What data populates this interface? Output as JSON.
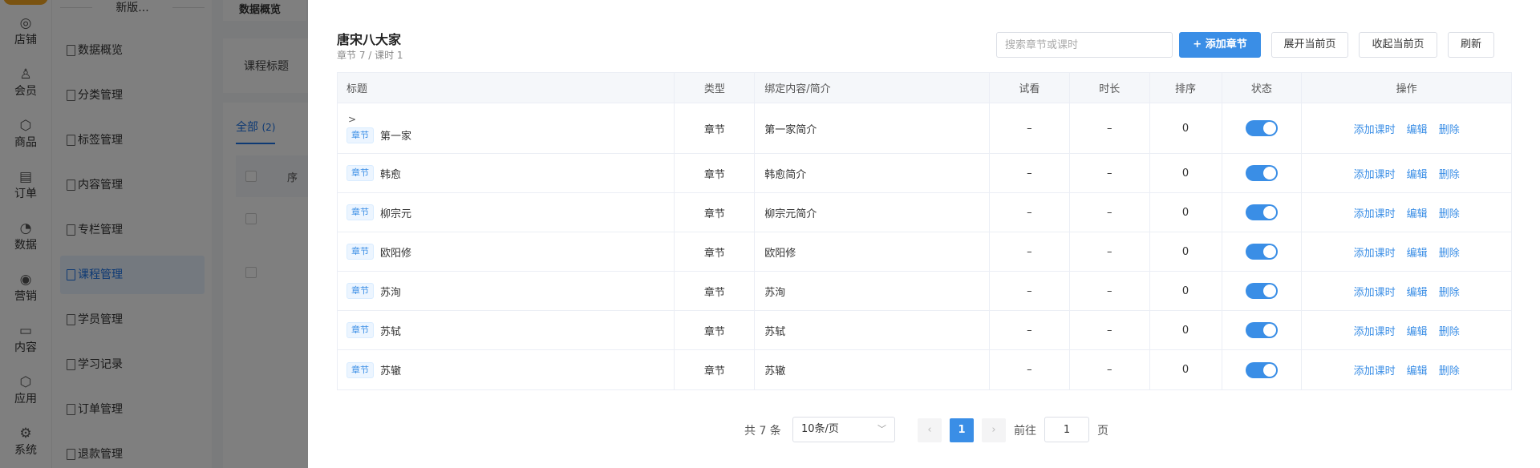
{
  "rail": {
    "items": [
      {
        "label": "店铺",
        "icon": "store-icon",
        "glyph": "◎"
      },
      {
        "label": "会员",
        "icon": "member-icon",
        "glyph": "♙"
      },
      {
        "label": "商品",
        "icon": "goods-icon",
        "glyph": "⬡"
      },
      {
        "label": "订单",
        "icon": "order-icon",
        "glyph": "▤"
      },
      {
        "label": "数据",
        "icon": "data-icon",
        "glyph": "◔"
      },
      {
        "label": "营销",
        "icon": "marketing-icon",
        "glyph": "◉"
      },
      {
        "label": "内容",
        "icon": "content-icon",
        "glyph": "▭"
      },
      {
        "label": "应用",
        "icon": "app-icon",
        "glyph": "⬡"
      },
      {
        "label": "系统",
        "icon": "system-icon",
        "glyph": "⚙"
      }
    ]
  },
  "sidebar": {
    "top_label": "新版...",
    "items": [
      {
        "label": "数据概览"
      },
      {
        "label": "分类管理"
      },
      {
        "label": "标签管理"
      },
      {
        "label": "内容管理"
      },
      {
        "label": "专栏管理"
      },
      {
        "label": "课程管理",
        "active": true
      },
      {
        "label": "学员管理"
      },
      {
        "label": "学习记录"
      },
      {
        "label": "订单管理"
      },
      {
        "label": "退款管理"
      }
    ]
  },
  "background": {
    "breadcrumb": "数据概览",
    "filter_label": "课程标题",
    "tab_all": "全部",
    "tab_all_count": "(2)",
    "partial_header": "序"
  },
  "drawer": {
    "title": "唐宋八大家",
    "subtitle": "章节 7 / 课时 1",
    "search_placeholder": "搜索章节或课时",
    "add_chapter": "+ 添加章节",
    "expand_page": "展开当前页",
    "collapse_page": "收起当前页",
    "refresh": "刷新",
    "columns": [
      "标题",
      "类型",
      "绑定内容/简介",
      "试看",
      "时长",
      "排序",
      "状态",
      "操作"
    ],
    "rows": [
      {
        "tag": "章节",
        "title": "第一家",
        "type": "章节",
        "bind": "第一家简介",
        "trial": "–",
        "duration": "–",
        "sort": "0",
        "status": true,
        "expandable": true
      },
      {
        "tag": "章节",
        "title": "韩愈",
        "type": "章节",
        "bind": "韩愈简介",
        "trial": "–",
        "duration": "–",
        "sort": "0",
        "status": true
      },
      {
        "tag": "章节",
        "title": "柳宗元",
        "type": "章节",
        "bind": "柳宗元简介",
        "trial": "–",
        "duration": "–",
        "sort": "0",
        "status": true
      },
      {
        "tag": "章节",
        "title": "欧阳修",
        "type": "章节",
        "bind": "欧阳修",
        "trial": "–",
        "duration": "–",
        "sort": "0",
        "status": true
      },
      {
        "tag": "章节",
        "title": "苏洵",
        "type": "章节",
        "bind": "苏洵",
        "trial": "–",
        "duration": "–",
        "sort": "0",
        "status": true
      },
      {
        "tag": "章节",
        "title": "苏轼",
        "type": "章节",
        "bind": "苏轼",
        "trial": "–",
        "duration": "–",
        "sort": "0",
        "status": true
      },
      {
        "tag": "章节",
        "title": "苏辙",
        "type": "章节",
        "bind": "苏辙",
        "trial": "–",
        "duration": "–",
        "sort": "0",
        "status": true
      }
    ],
    "ops": {
      "add_lesson": "添加课时",
      "edit": "编辑",
      "delete": "删除"
    },
    "pagination": {
      "total": "共 7 条",
      "page_size": "10条/页",
      "prev": "‹",
      "current": "1",
      "next": "›",
      "goto_label": "前往",
      "goto_value": "1",
      "page_suffix": "页"
    }
  },
  "colors": {
    "accent": "#3a8ee6",
    "overlay": "rgba(0,0,0,0.5)"
  }
}
